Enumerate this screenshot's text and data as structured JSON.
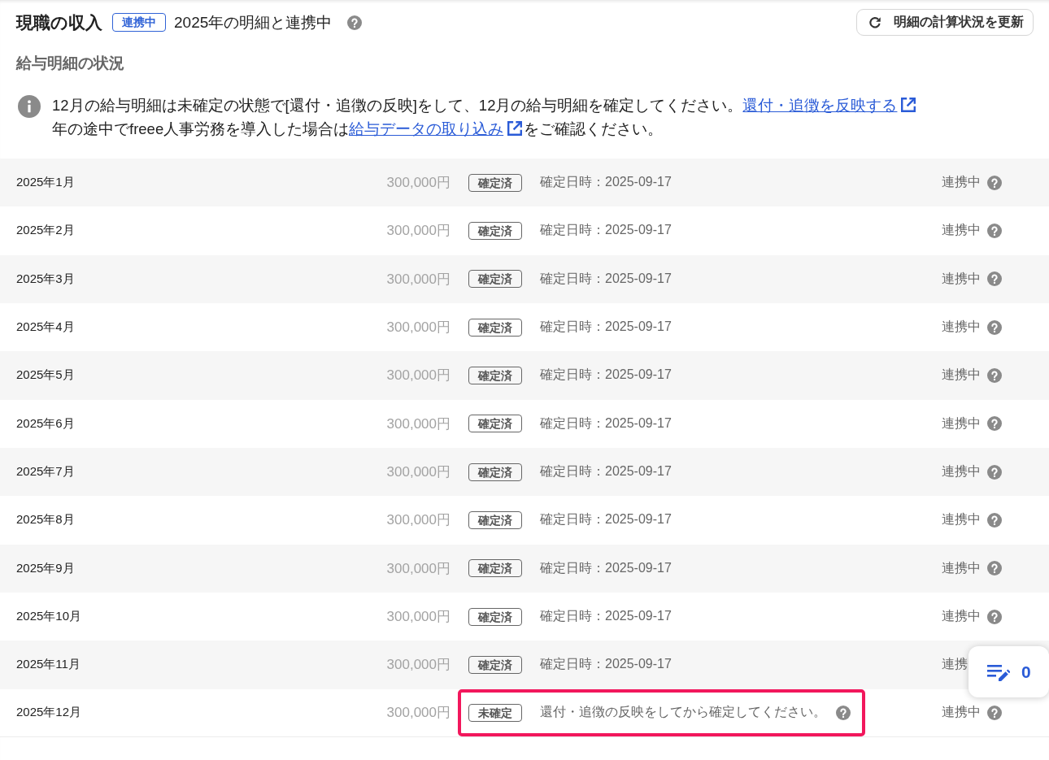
{
  "header": {
    "title": "現職の収入",
    "badge": "連携中",
    "description": "2025年の明細と連携中",
    "refresh_button": "明細の計算状況を更新"
  },
  "section_title": "給与明細の状況",
  "notice": {
    "lines": [
      [
        {
          "kind": "text",
          "text": "12月の給与明細は未確定の状態で[還付・追徴の反映]をして、12月の給与明細を確定してください。"
        },
        {
          "kind": "link",
          "text": "還付・追徴を反映する"
        }
      ],
      [
        {
          "kind": "text",
          "text": "年の途中でfreee人事労務を導入した場合は"
        },
        {
          "kind": "link",
          "text": "給与データの取り込み"
        },
        {
          "kind": "text",
          "text": "をご確認ください。"
        }
      ]
    ]
  },
  "rows": [
    {
      "month": "2025年1月",
      "amount": "300,000円",
      "badge": "確定済",
      "note": "確定日時：2025-09-17",
      "note_help": false,
      "sync": "連携中",
      "sync_help": true,
      "highlighted": false
    },
    {
      "month": "2025年2月",
      "amount": "300,000円",
      "badge": "確定済",
      "note": "確定日時：2025-09-17",
      "note_help": false,
      "sync": "連携中",
      "sync_help": true,
      "highlighted": false
    },
    {
      "month": "2025年3月",
      "amount": "300,000円",
      "badge": "確定済",
      "note": "確定日時：2025-09-17",
      "note_help": false,
      "sync": "連携中",
      "sync_help": true,
      "highlighted": false
    },
    {
      "month": "2025年4月",
      "amount": "300,000円",
      "badge": "確定済",
      "note": "確定日時：2025-09-17",
      "note_help": false,
      "sync": "連携中",
      "sync_help": true,
      "highlighted": false
    },
    {
      "month": "2025年5月",
      "amount": "300,000円",
      "badge": "確定済",
      "note": "確定日時：2025-09-17",
      "note_help": false,
      "sync": "連携中",
      "sync_help": true,
      "highlighted": false
    },
    {
      "month": "2025年6月",
      "amount": "300,000円",
      "badge": "確定済",
      "note": "確定日時：2025-09-17",
      "note_help": false,
      "sync": "連携中",
      "sync_help": true,
      "highlighted": false
    },
    {
      "month": "2025年7月",
      "amount": "300,000円",
      "badge": "確定済",
      "note": "確定日時：2025-09-17",
      "note_help": false,
      "sync": "連携中",
      "sync_help": true,
      "highlighted": false
    },
    {
      "month": "2025年8月",
      "amount": "300,000円",
      "badge": "確定済",
      "note": "確定日時：2025-09-17",
      "note_help": false,
      "sync": "連携中",
      "sync_help": true,
      "highlighted": false
    },
    {
      "month": "2025年9月",
      "amount": "300,000円",
      "badge": "確定済",
      "note": "確定日時：2025-09-17",
      "note_help": false,
      "sync": "連携中",
      "sync_help": true,
      "highlighted": false
    },
    {
      "month": "2025年10月",
      "amount": "300,000円",
      "badge": "確定済",
      "note": "確定日時：2025-09-17",
      "note_help": false,
      "sync": "連携中",
      "sync_help": true,
      "highlighted": false
    },
    {
      "month": "2025年11月",
      "amount": "300,000円",
      "badge": "確定済",
      "note": "確定日時：2025-09-17",
      "note_help": false,
      "sync": "連携",
      "sync_help": false,
      "highlighted": false
    },
    {
      "month": "2025年12月",
      "amount": "300,000円",
      "badge": "未確定",
      "note": "還付・追徴の反映をしてから確定してください。",
      "note_help": true,
      "sync": "連携中",
      "sync_help": true,
      "highlighted": true
    }
  ],
  "floating_button": {
    "count": "0"
  }
}
